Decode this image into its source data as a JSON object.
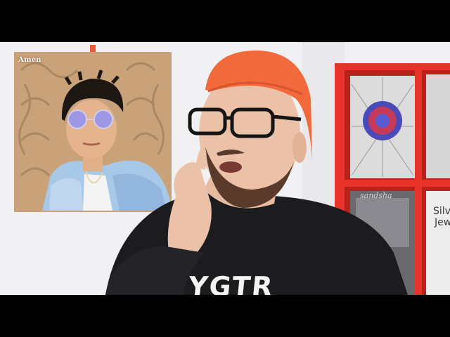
{
  "poster": {
    "label": "Amen"
  },
  "shirt": {
    "text": "YGTR"
  },
  "records": {
    "label_1": "Silv",
    "label_2": "Jew",
    "label_3": "sandsha"
  },
  "colors": {
    "letterbox": "#000000",
    "wall": "#f2f2f3",
    "shelf": "#e8332a",
    "beanie": "#f26a3c",
    "shirt": "#1c1c1f",
    "jacket": "#a8c8e8"
  }
}
